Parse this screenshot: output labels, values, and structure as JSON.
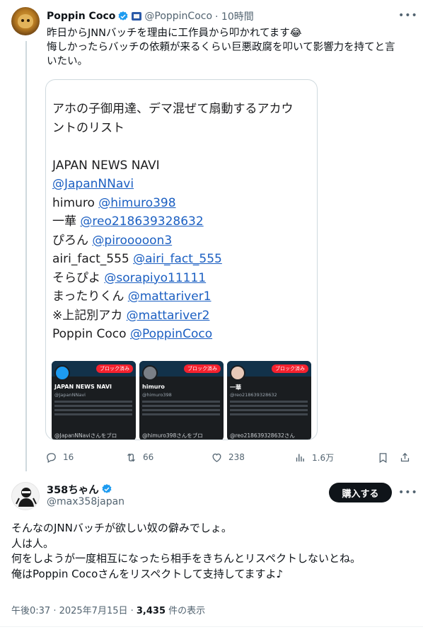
{
  "tweet1": {
    "display_name": "Poppin Coco",
    "handle": "@PoppinCoco",
    "time": "· 10時間",
    "text_lines": [
      "昨日からJNNバッチを理由に工作員から叩かれてます😂",
      "悔しかったらバッチの依頼が来るくらい巨悪政腐を叩いて影響力を持てと言",
      "いたい。"
    ],
    "media": {
      "lines": [
        {
          "plain": "アホの子御用達、デマ混ぜて扇動するアカウ",
          "link": ""
        },
        {
          "plain": "ントのリスト",
          "link": ""
        },
        {
          "plain": "",
          "link": ""
        },
        {
          "plain": "JAPAN NEWS NAVI",
          "link": ""
        },
        {
          "plain": "",
          "link": "@JapanNNavi"
        },
        {
          "plain": "himuro ",
          "link": "@himuro398"
        },
        {
          "plain": "一華 ",
          "link": "@reo218639328632"
        },
        {
          "plain": "ぴろん ",
          "link": "@pirooooon3"
        },
        {
          "plain": "airi_fact_555 ",
          "link": "@airi_fact_555"
        },
        {
          "plain": "そらぴよ ",
          "link": "@sorapiyo11111"
        },
        {
          "plain": "まったりくん ",
          "link": "@mattariver1"
        },
        {
          "plain": " ※上記別アカ ",
          "link": "@mattariver2"
        },
        {
          "plain": "Poppin Coco ",
          "link": "@PoppinCoco"
        }
      ],
      "panels": [
        {
          "name": "JAPAN NEWS NAVI",
          "handle": "@JapanNNavi",
          "blocked": "ブロック済み",
          "footer": "@JapanNNaviさんをブロ",
          "avatar_color": "#1d9bf0"
        },
        {
          "name": "himuro",
          "handle": "@himuro398",
          "blocked": "ブロック済み",
          "footer": "@himuro398さんをブロ",
          "avatar_color": "#7a7f86"
        },
        {
          "name": "一華",
          "handle": "@reo218639328632",
          "blocked": "ブロック済み",
          "footer": "@reo218639328632さん",
          "avatar_color": "#e8c9b8"
        }
      ]
    },
    "stats": {
      "replies": "16",
      "retweets": "66",
      "likes": "238",
      "views": "1.6万"
    }
  },
  "tweet2": {
    "display_name": "358ちゃん",
    "handle": "@max358japan",
    "buy_label": "購入する",
    "text_lines": [
      "そんなのJNNバッチが欲しい奴の僻みでしょ。",
      "人は人。",
      "何をしようが一度相互になったら相手をきちんとリスペクトしないとね。",
      "俺はPoppin Cocoさんをリスペクトして支持してますよ♪"
    ],
    "timestamp": "午後0:37 · 2025年7月15日 · ",
    "view_count": "3,435",
    "view_suffix": " 件の表示"
  },
  "colors": {
    "verified": "#1d9bf0",
    "link": "#1b5fc2",
    "muted": "#536471",
    "blocked_badge": "#f4212e"
  }
}
